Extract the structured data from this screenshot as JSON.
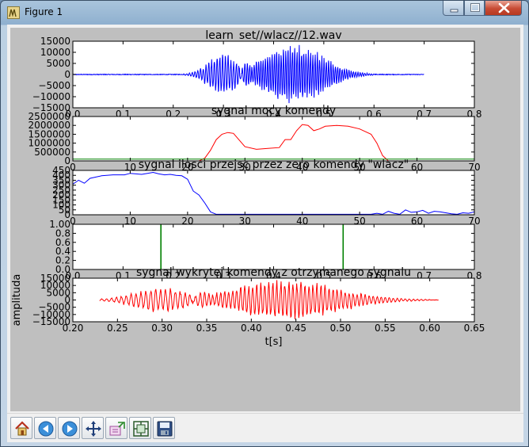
{
  "window": {
    "title": "Figure 1"
  },
  "toolbar": {
    "items": [
      "home-icon",
      "back-icon",
      "forward-icon",
      "pan-icon",
      "subplots-icon",
      "zoom-icon",
      "save-icon"
    ]
  },
  "colors": {
    "blue": "#0000ff",
    "red": "#ff0000",
    "green": "#008000",
    "figure_bg": "#bfbfbf"
  },
  "chart_data": [
    {
      "type": "line",
      "title": "learn_set//wlacz//12.wav",
      "xlim": [
        0,
        0.8
      ],
      "ylim": [
        -15000,
        15000
      ],
      "xticks": [
        "0.0",
        "0.1",
        "0.2",
        "0.3",
        "0.4",
        "0.5",
        "0.6",
        "0.7",
        "0.8"
      ],
      "yticks": [
        "15000",
        "10000",
        "5000",
        "0",
        "−5000",
        "−10000",
        "−15000"
      ],
      "ytick_values": [
        15000,
        10000,
        5000,
        0,
        -5000,
        -10000,
        -15000
      ],
      "xtick_values": [
        0,
        0.1,
        0.2,
        0.3,
        0.4,
        0.5,
        0.6,
        0.7,
        0.8
      ],
      "series": [
        {
          "color": "#0000ff",
          "x_range": [
            0,
            0.7
          ],
          "bursts": [
            {
              "start": 0.22,
              "end": 0.36,
              "peak_t": 0.3,
              "peak": 9500,
              "cycle": 0.0055
            },
            {
              "start": 0.33,
              "end": 0.6,
              "peak_t": 0.44,
              "peak": 14000,
              "cycle": 0.0045
            }
          ]
        }
      ]
    },
    {
      "type": "line",
      "title": "sygnal mocy komendy",
      "xlim": [
        0,
        70
      ],
      "ylim": [
        0,
        2500000
      ],
      "xticks": [
        "0",
        "10",
        "20",
        "30",
        "40",
        "50",
        "60",
        "70"
      ],
      "xtick_values": [
        0,
        10,
        20,
        30,
        40,
        50,
        60,
        70
      ],
      "yticks": [
        "2500000",
        "2000000",
        "1500000",
        "1000000",
        "500000",
        "0"
      ],
      "ytick_values": [
        2500000,
        2000000,
        1500000,
        1000000,
        500000,
        0
      ],
      "series": [
        {
          "color": "#ff0000",
          "x": [
            0,
            22,
            23,
            24,
            25,
            26,
            27,
            28,
            30,
            32,
            34,
            36,
            37,
            38,
            39,
            40,
            41,
            42,
            43,
            44,
            46,
            48,
            50,
            52,
            53,
            54,
            55,
            56,
            70
          ],
          "y": [
            0,
            0,
            150000,
            600000,
            1200000,
            1500000,
            1600000,
            1550000,
            800000,
            650000,
            700000,
            750000,
            1200000,
            1200000,
            1700000,
            2050000,
            2000000,
            1700000,
            1800000,
            1950000,
            2000000,
            1950000,
            1800000,
            1500000,
            1000000,
            300000,
            0,
            0,
            0
          ]
        },
        {
          "color": "#008000",
          "x": [
            0,
            70
          ],
          "y": [
            100000,
            100000
          ]
        }
      ]
    },
    {
      "type": "line",
      "title": "sygnal ilosci przejsc przez zero komendy \"wlacz\"",
      "xlim": [
        0,
        70
      ],
      "ylim": [
        0,
        450
      ],
      "xticks": [
        "0",
        "10",
        "20",
        "30",
        "40",
        "50",
        "60",
        "70"
      ],
      "xtick_values": [
        0,
        10,
        20,
        30,
        40,
        50,
        60,
        70
      ],
      "yticks": [
        "450",
        "400",
        "350",
        "300",
        "250",
        "200",
        "150",
        "100",
        "50",
        "0"
      ],
      "ytick_values": [
        450,
        400,
        350,
        300,
        250,
        200,
        150,
        100,
        50,
        0
      ],
      "series": [
        {
          "color": "#0000ff",
          "x": [
            0,
            1,
            2,
            3,
            5,
            7,
            9,
            10,
            11,
            12,
            13,
            14,
            15,
            16,
            17,
            18,
            19,
            20,
            21,
            22,
            23,
            24,
            25,
            30,
            40,
            50,
            52,
            53,
            54,
            55,
            56,
            57,
            58,
            59,
            60,
            61,
            62,
            63,
            64,
            65,
            66,
            67,
            68,
            69,
            70
          ],
          "y": [
            310,
            350,
            320,
            370,
            395,
            405,
            405,
            420,
            415,
            410,
            420,
            430,
            415,
            405,
            410,
            400,
            395,
            360,
            240,
            200,
            120,
            30,
            5,
            5,
            5,
            5,
            5,
            15,
            5,
            35,
            15,
            5,
            50,
            25,
            30,
            45,
            15,
            35,
            30,
            20,
            10,
            5,
            20,
            15,
            30
          ]
        }
      ]
    },
    {
      "type": "line",
      "title": "",
      "xlim": [
        0,
        0.8
      ],
      "ylim": [
        0,
        1
      ],
      "xticks": [
        "0.0",
        "0.1",
        "0.2",
        "0.3",
        "0.4",
        "0.5",
        "0.6",
        "0.7",
        "0.8"
      ],
      "xtick_values": [
        0,
        0.1,
        0.2,
        0.3,
        0.4,
        0.5,
        0.6,
        0.7,
        0.8
      ],
      "yticks": [
        "1.00",
        "0.8",
        "0.6",
        "0.4",
        "0.2",
        "0.0"
      ],
      "ytick_values": [
        1,
        0.8,
        0.6,
        0.4,
        0.2,
        0
      ],
      "series": [
        {
          "color": "#008000",
          "x": [
            0,
            0.175,
            0.175,
            0.176,
            0.176,
            0.538,
            0.538,
            0.539,
            0.539,
            0.8
          ],
          "y": [
            0,
            0,
            1,
            1,
            0,
            0,
            1,
            1,
            0,
            0
          ]
        }
      ]
    },
    {
      "type": "line",
      "title": "sygnal wykrytej komendy z otrzymanego sygnalu",
      "xlabel": "t[s]",
      "ylabel": "amplituda",
      "xlim": [
        0.2,
        0.65
      ],
      "ylim": [
        -15000,
        15000
      ],
      "xticks": [
        "0.20",
        "0.25",
        "0.30",
        "0.35",
        "0.40",
        "0.45",
        "0.50",
        "0.55",
        "0.60",
        "0.65"
      ],
      "xtick_values": [
        0.2,
        0.25,
        0.3,
        0.35,
        0.4,
        0.45,
        0.5,
        0.55,
        0.6,
        0.65
      ],
      "yticks": [
        "15000",
        "10000",
        "5000",
        "0",
        "−5000",
        "−10000",
        "−15000"
      ],
      "ytick_values": [
        15000,
        10000,
        5000,
        0,
        -5000,
        -10000,
        -15000
      ],
      "series": [
        {
          "color": "#ff0000",
          "x_range": [
            0.23,
            0.61
          ],
          "bursts": [
            {
              "start": 0.22,
              "end": 0.36,
              "peak_t": 0.3,
              "peak": 9000,
              "cycle": 0.0055
            },
            {
              "start": 0.33,
              "end": 0.6,
              "peak_t": 0.44,
              "peak": 14000,
              "cycle": 0.0045
            }
          ]
        }
      ]
    }
  ]
}
